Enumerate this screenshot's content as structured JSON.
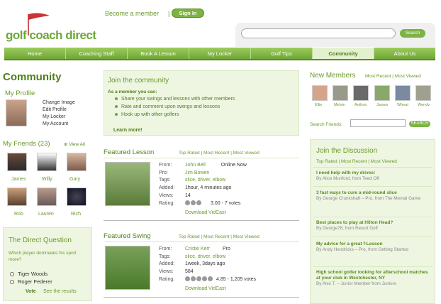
{
  "header": {
    "become_member": "Become a member",
    "sign_in": "Sign In",
    "logo": "golf coach direct",
    "search_btn": "Search",
    "search_placeholder": ""
  },
  "nav": [
    "Home",
    "Coaching Staff",
    "Book A Lesson",
    "My Locker",
    "Golf Tips",
    "Community",
    "About Us"
  ],
  "left": {
    "title": "Community",
    "profile_title": "My Profile",
    "profile_links": [
      "Change Image",
      "Edit Profile",
      "My Locker",
      "My Account"
    ],
    "friends_title": "My Friends (23)",
    "view_all": "View All",
    "friends": [
      "James",
      "Willy",
      "Gary",
      "Rob",
      "Lauren",
      "Rich"
    ],
    "question_title": "The Direct Question",
    "question": "Which player dominates his sport more?",
    "options": [
      "Tiger Woods",
      "Roger Federer"
    ],
    "vote": "Vote",
    "see_results": "See the results"
  },
  "join": {
    "title": "Join the community",
    "intro": "As a member you can:",
    "items": [
      "Share your swings and lessons with other members",
      "Rate and comment upon swings and lessons",
      "Hook up with other golfers"
    ],
    "learn": "Learn more!"
  },
  "lesson": {
    "title": "Featured Lesson",
    "tabs": [
      "Top Rated",
      "Most Recent",
      "Most Viewed"
    ],
    "labels": [
      "From:",
      "Pro:",
      "Tags:",
      "Added:",
      "Views:",
      "Rating:"
    ],
    "from": "John Bell",
    "status": "Online Now",
    "pro": "Jim Bowen",
    "tags": "slice, driver, elbow",
    "added": "1hour, 4 minutes ago",
    "views": "14",
    "rating": "3.00 - 7 votes",
    "download": "Download VidCast"
  },
  "swing": {
    "title": "Featured Swing",
    "tabs": [
      "Top Rated",
      "Most Recent",
      "Most Viewed"
    ],
    "labels": [
      "From:",
      "Tags:",
      "Added:",
      "Views:",
      "Rating:"
    ],
    "from": "Cristie Kerr",
    "status": "Pro",
    "tags": "slice, driver, elbow",
    "added": "1week, 3days ago",
    "views": "584",
    "rating": "4.85 - 1,205 votes",
    "download": "Download VidCast"
  },
  "members": {
    "title": "New Members",
    "tabs": [
      "Most Recent",
      "Most Viewed"
    ],
    "names": [
      "Ellie",
      "Melvin",
      "Anthon",
      "James",
      "Wheat",
      "Wendv"
    ],
    "search_label": "Search Friends:",
    "search_btn": "SEARCH"
  },
  "discussion": {
    "title": "Join the Discussion",
    "tabs": [
      "Top Rated",
      "Most Recent",
      "Most Viewed"
    ],
    "items": [
      {
        "t": "I need help with my drives!",
        "b": "By Alice Munford, from Teed Off"
      },
      {
        "t": "3 fast ways to cure a mid-round slice",
        "b": "By George Crunkshaft – Pro, from The Mental Game"
      },
      {
        "t": "Best places to play at Hilton Head?",
        "b": "By George78, from Resort Golf"
      },
      {
        "t": "My advice for a great f-Lesson",
        "b": "By Andy Hendricks – Pro, from Getting Started"
      },
      {
        "t": "High school golfer looking for afterschool matches at your club in Westchester, NY",
        "b": "By Alex T. – Junior Member from Juniors"
      }
    ]
  }
}
